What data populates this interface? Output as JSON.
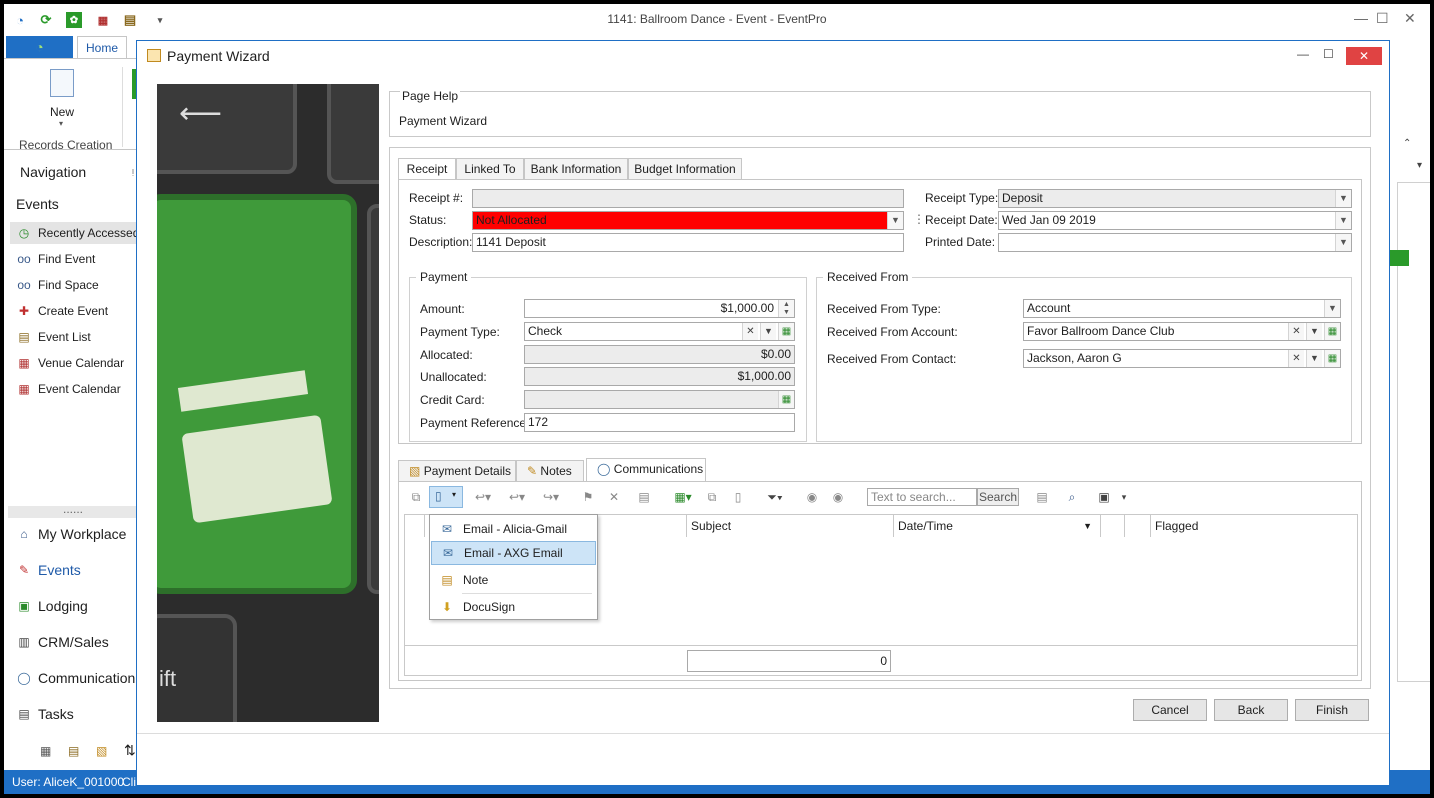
{
  "app": {
    "title": "1141: Ballroom Dance - Event - EventPro",
    "home_tab": "Home",
    "new_label": "New",
    "records_creation": "Records Creation"
  },
  "nav": {
    "header": "Navigation",
    "section": "Events",
    "items": [
      {
        "label": "Recently Accessed E",
        "icon": "clock-icon"
      },
      {
        "label": "Find Event",
        "icon": "binoculars-icon"
      },
      {
        "label": "Find Space",
        "icon": "binoculars-icon"
      },
      {
        "label": "Create Event",
        "icon": "create-event-icon"
      },
      {
        "label": "Event List",
        "icon": "list-icon"
      },
      {
        "label": "Venue Calendar",
        "icon": "calendar-icon"
      },
      {
        "label": "Event Calendar",
        "icon": "calendar-icon"
      }
    ],
    "splitter": "......",
    "big_items": [
      {
        "label": "My Workplace",
        "icon": "home-icon"
      },
      {
        "label": "Events",
        "icon": "pushpin-icon"
      },
      {
        "label": "Lodging",
        "icon": "lodging-icon"
      },
      {
        "label": "CRM/Sales",
        "icon": "crm-icon"
      },
      {
        "label": "Communication",
        "icon": "speech-bubble-icon"
      },
      {
        "label": "Tasks",
        "icon": "tasks-icon"
      }
    ]
  },
  "status": {
    "user": "User: AliceK_001000",
    "cl": "Cli"
  },
  "dialog": {
    "title": "Payment Wizard",
    "page_help": {
      "title": "Page Help",
      "text": "Payment Wizard"
    },
    "tabs": [
      "Receipt",
      "Linked To",
      "Bank Information",
      "Budget Information"
    ],
    "receipt": {
      "receipt_no_label": "Receipt #:",
      "receipt_no": "",
      "status_label": "Status:",
      "status": "Not Allocated",
      "status_color": "#ff0000",
      "description_label": "Description:",
      "description": "1141 Deposit",
      "receipt_type_label": "Receipt Type:",
      "receipt_type": "Deposit",
      "receipt_date_label": "Receipt Date:",
      "receipt_date": "Wed Jan 09 2019",
      "printed_date_label": "Printed Date:",
      "printed_date": ""
    },
    "payment": {
      "title": "Payment",
      "amount_label": "Amount:",
      "amount": "$1,000.00",
      "type_label": "Payment Type:",
      "type": "Check",
      "allocated_label": "Allocated:",
      "allocated": "$0.00",
      "unallocated_label": "Unallocated:",
      "unallocated": "$1,000.00",
      "credit_card_label": "Credit Card:",
      "credit_card": "",
      "reference_label": "Payment Reference:",
      "reference": "172"
    },
    "received_from": {
      "title": "Received From",
      "type_label": "Received From Type:",
      "type": "Account",
      "account_label": "Received From Account:",
      "account": "Favor Ballroom Dance Club",
      "contact_label": "Received From Contact:",
      "contact": "Jackson, Aaron G"
    },
    "sub_tabs": [
      "Payment Details",
      "Notes",
      "Communications"
    ],
    "search": {
      "placeholder": "Text to search...",
      "button": "Search"
    },
    "grid": {
      "columns": [
        "Subject",
        "Date/Time",
        "Flagged"
      ],
      "footer_count": "0"
    },
    "menu": [
      "Email - Alicia-Gmail",
      "Email - AXG Email",
      "Note",
      "DocuSign"
    ],
    "buttons": {
      "cancel": "Cancel",
      "back": "Back",
      "finish": "Finish"
    },
    "image_text": "ift"
  }
}
